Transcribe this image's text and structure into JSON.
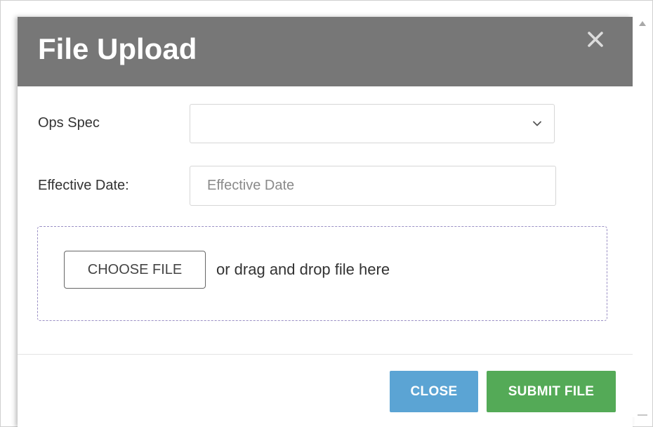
{
  "dialog": {
    "title": "File Upload",
    "close_icon": "close-x-icon"
  },
  "form": {
    "ops_spec": {
      "label": "Ops Spec",
      "value": "",
      "icon": "chevron-down-icon"
    },
    "effective_date": {
      "label": "Effective Date:",
      "value": "",
      "placeholder": "Effective Date"
    }
  },
  "upload": {
    "choose_label": "CHOOSE FILE",
    "drag_text": "or drag and drop file here"
  },
  "footer": {
    "close_label": "CLOSE",
    "submit_label": "SUBMIT FILE"
  },
  "colors": {
    "header_bg": "#777777",
    "close_btn": "#5ba4d4",
    "submit_btn": "#54aa57",
    "dropzone_border": "#9a8fc4"
  }
}
